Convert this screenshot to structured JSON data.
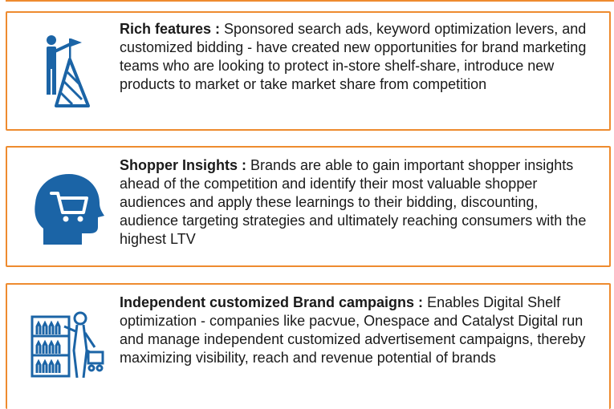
{
  "colors": {
    "border": "#ee8b2f",
    "icon": "#1b64a6",
    "text": "#1a1a1a"
  },
  "cards": [
    {
      "icon": "climber-summit-flag-icon",
      "title": "Rich features :",
      "body": " Sponsored search ads, keyword optimization levers, and customized bidding - have created new opportunities for brand marketing teams who are looking to protect in-store shelf-share, introduce new products to market or take market share from competition"
    },
    {
      "icon": "head-shopping-cart-icon",
      "title": "Shopper Insights :",
      "body": " Brands are able to gain important shopper insights ahead of the competition and identify their most valuable shopper audiences and apply these learnings to their bidding, discounting, audience targeting strategies and ultimately reaching consumers with the highest LTV"
    },
    {
      "icon": "shelf-shopper-icon",
      "title": "Independent customized Brand campaigns :",
      "body": " Enables Digital Shelf optimization - companies like pacvue, Onespace and Catalyst Digital run and manage independent customized advertisement campaigns, thereby maximizing visibility, reach and revenue potential of brands"
    }
  ]
}
